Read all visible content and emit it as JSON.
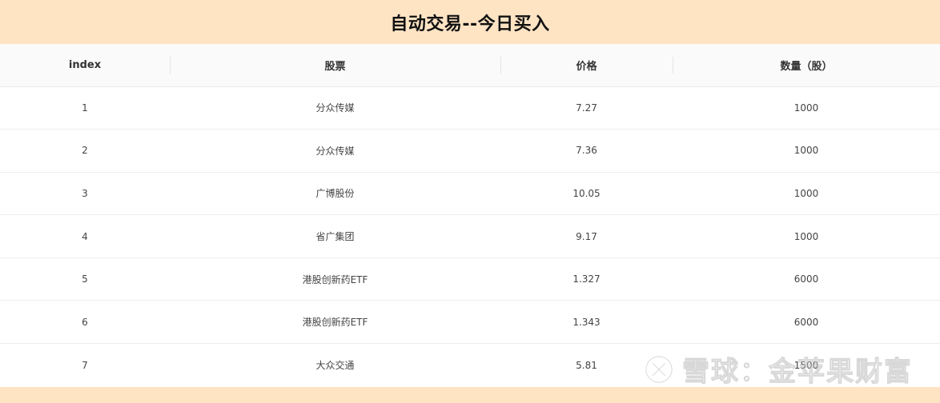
{
  "title": "自动交易--今日买入",
  "table": {
    "headers": [
      "index",
      "股票",
      "价格",
      "数量（股）"
    ],
    "rows": [
      [
        "1",
        "分众传媒",
        "7.27",
        "1000"
      ],
      [
        "2",
        "分众传媒",
        "7.36",
        "1000"
      ],
      [
        "3",
        "广博股份",
        "10.05",
        "1000"
      ],
      [
        "4",
        "省广集团",
        "9.17",
        "1000"
      ],
      [
        "5",
        "港股创新药ETF",
        "1.327",
        "6000"
      ],
      [
        "6",
        "港股创新药ETF",
        "1.343",
        "6000"
      ],
      [
        "7",
        "大众交通",
        "5.81",
        "1500"
      ]
    ]
  },
  "watermark": {
    "text": "雪球：金苹果财富",
    "icon": "xueqiu-logo-icon"
  },
  "colors": {
    "banner_bg": "#ffe4c4",
    "header_bg": "#fafafa",
    "row_bg": "#ffffff"
  }
}
